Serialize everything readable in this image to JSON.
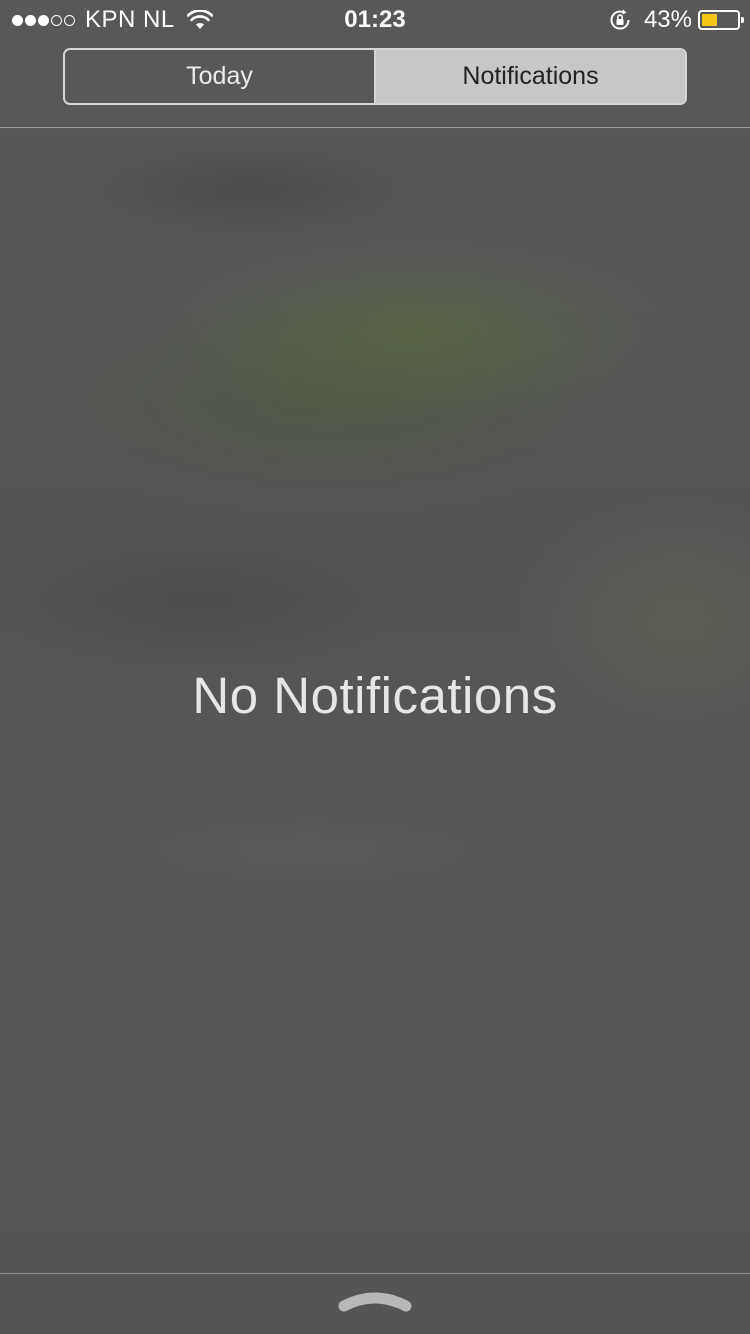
{
  "status_bar": {
    "carrier": "KPN NL",
    "signal_bars_filled": 3,
    "signal_bars_total": 5,
    "time": "01:23",
    "battery_percent": "43%",
    "battery_level": 0.43,
    "battery_color": "#f5c518"
  },
  "segmented_control": {
    "tabs": [
      {
        "label": "Today",
        "selected": false
      },
      {
        "label": "Notifications",
        "selected": true
      }
    ]
  },
  "main": {
    "empty_message": "No Notifications"
  },
  "icons": {
    "wifi": "wifi-icon",
    "rotation_lock": "rotation-lock-icon",
    "battery": "battery-icon",
    "handle": "chevron-up-handle-icon"
  }
}
